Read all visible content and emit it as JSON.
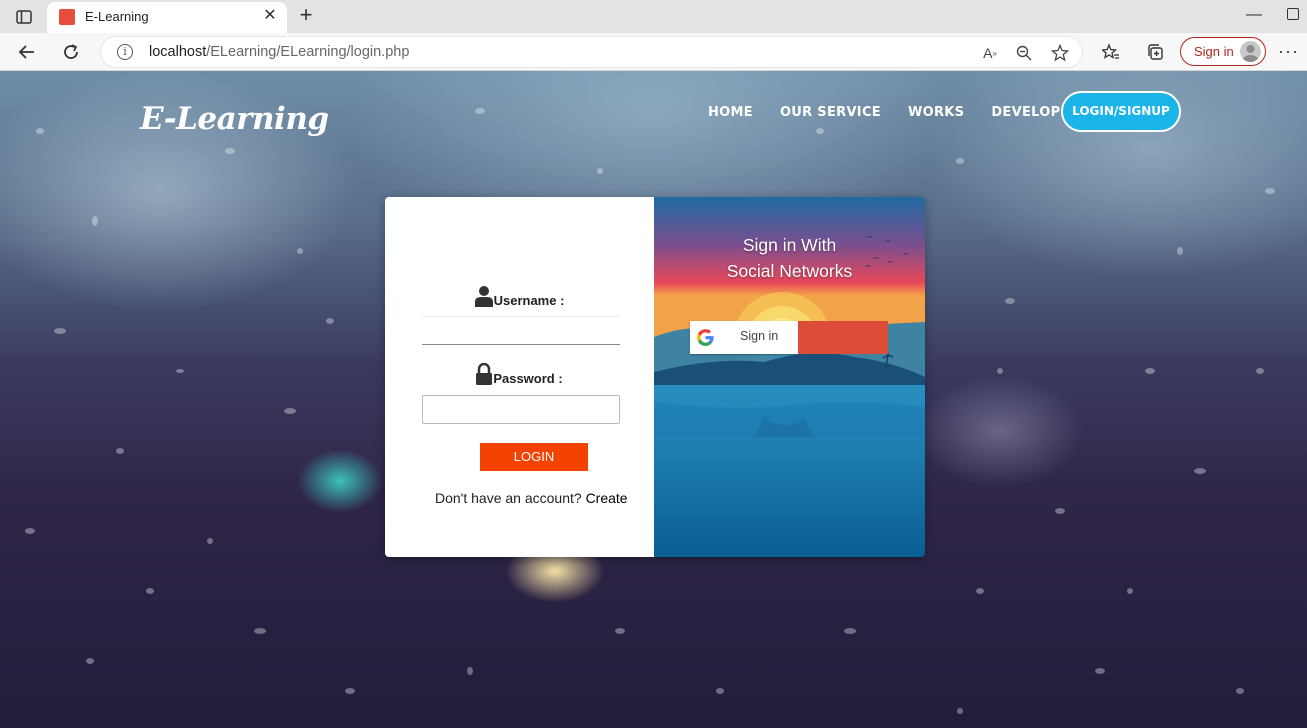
{
  "browser": {
    "tab_title": "E-Learning",
    "url_host": "localhost",
    "url_path": "/ELearning/ELearning/login.php",
    "profile_button": "Sign in"
  },
  "site": {
    "brand": "E-Learning",
    "nav": [
      "HOME",
      "OUR SERVICE",
      "WORKS",
      "DEVELOPER"
    ],
    "nav_cta": "LOGIN/SIGNUP"
  },
  "login": {
    "username_label": "Username :",
    "password_label": "Password :",
    "username_value": "",
    "password_value": "",
    "login_button": "LOGIN",
    "signup_prompt": "Don't have an account?",
    "signup_link": "Create"
  },
  "social": {
    "title_line1": "Sign in With",
    "title_line2": "Social Networks",
    "google_button": "Sign in"
  },
  "colors": {
    "login_button": "#f44203",
    "nav_cta": "#1bb4e8",
    "google_red": "#dd4b39",
    "profile_accent": "#b3261e"
  },
  "icons": {
    "username": "user-icon",
    "password": "lock-icon"
  }
}
